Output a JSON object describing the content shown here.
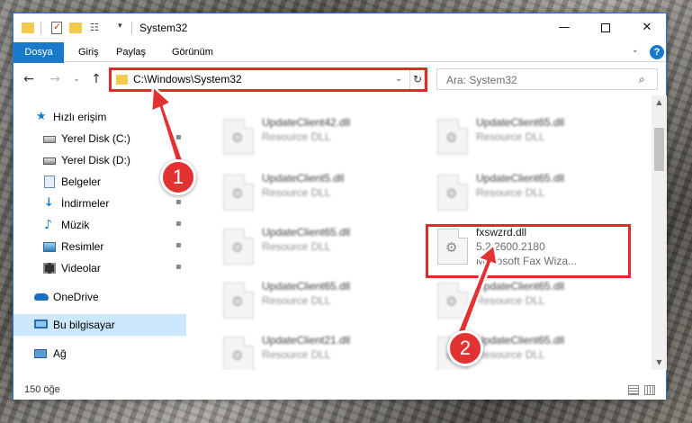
{
  "window": {
    "title": "System32",
    "qa_dropdown": "▾",
    "minimize": "—",
    "close": "✕"
  },
  "ribbon": {
    "tabs": [
      "Dosya",
      "Giriş",
      "Paylaş",
      "Görünüm"
    ],
    "expand": "⌄",
    "help": "?"
  },
  "nav": {
    "back": "←",
    "forward": "→",
    "recent": "⌄",
    "up": "↑",
    "address": "C:\\Windows\\System32",
    "address_drop": "⌄",
    "refresh": "↻",
    "search_placeholder": "Ara: System32",
    "search_icon": "⌕"
  },
  "sidebar": {
    "items": [
      {
        "label": "Hızlı erişim",
        "icon": "star-icon"
      },
      {
        "label": "Yerel Disk (C:)",
        "icon": "drive-icon",
        "pinned": true
      },
      {
        "label": "Yerel Disk (D:)",
        "icon": "drive-icon",
        "pinned": true
      },
      {
        "label": "Belgeler",
        "icon": "documents-icon",
        "pinned": true
      },
      {
        "label": "İndirmeler",
        "icon": "download-icon",
        "pinned": true
      },
      {
        "label": "Müzik",
        "icon": "music-icon",
        "pinned": true
      },
      {
        "label": "Resimler",
        "icon": "pictures-icon",
        "pinned": true
      },
      {
        "label": "Videolar",
        "icon": "videos-icon",
        "pinned": true
      },
      {
        "label": "OneDrive",
        "icon": "cloud-icon"
      },
      {
        "label": "Bu bilgisayar",
        "icon": "computer-icon",
        "selected": true
      },
      {
        "label": "Ağ",
        "icon": "network-icon"
      }
    ],
    "pin_glyph": "📌"
  },
  "files": [
    {
      "name": "UpdateClient42.dll",
      "desc": "Resource DLL"
    },
    {
      "name": "UpdateClient65.dll",
      "desc": "Resource DLL"
    },
    {
      "name": "UpdateClient5.dll",
      "desc": "Resource DLL"
    },
    {
      "name": "UpdateClient65.dll",
      "desc": "Resource DLL"
    },
    {
      "name": "UpdateClient65.dll",
      "desc": "Resource DLL"
    },
    {
      "name": "fxswzrd.dll",
      "desc": "5.2.2600.2180",
      "desc2": "Microsoft  Fax Wiza..."
    },
    {
      "name": "UpdateClient65.dll",
      "desc": "Resource DLL"
    },
    {
      "name": "UpdateClient65.dll",
      "desc": "Resource DLL"
    },
    {
      "name": "UpdateClient21.dll",
      "desc": "Resource DLL"
    },
    {
      "name": "UpdateClient65.dll",
      "desc": "Resource DLL"
    }
  ],
  "status": {
    "count": "150 öğe"
  },
  "annotations": {
    "badge1": "1",
    "badge2": "2",
    "color": "#e23232"
  }
}
